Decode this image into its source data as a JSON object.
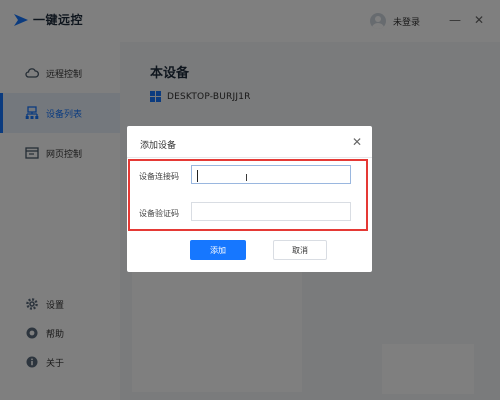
{
  "app": {
    "name": "一键远控"
  },
  "titlebar": {
    "user_label": "未登录",
    "minimize_glyph": "—",
    "close_glyph": "✕"
  },
  "sidebar": {
    "items": [
      {
        "label": "远程控制",
        "icon": "cloud-icon",
        "active": false
      },
      {
        "label": "设备列表",
        "icon": "device-list-icon",
        "active": true
      },
      {
        "label": "网页控制",
        "icon": "web-icon",
        "active": false
      }
    ],
    "bottom_items": [
      {
        "label": "设置",
        "icon": "gear-icon"
      },
      {
        "label": "帮助",
        "icon": "help-icon"
      },
      {
        "label": "关于",
        "icon": "info-icon"
      }
    ]
  },
  "main": {
    "title": "本设备",
    "device_name": "DESKTOP-BURJJ1R"
  },
  "dialog": {
    "title": "添加设备",
    "close_glyph": "✕",
    "connect_code_label": "设备连接码",
    "connect_code_value": "",
    "verify_code_label": "设备验证码",
    "verify_code_value": "",
    "confirm_label": "添加",
    "cancel_label": "取消"
  },
  "colors": {
    "accent": "#1677ff",
    "highlight": "#e53935",
    "overlay": "rgba(0,0,0,0.5)"
  }
}
